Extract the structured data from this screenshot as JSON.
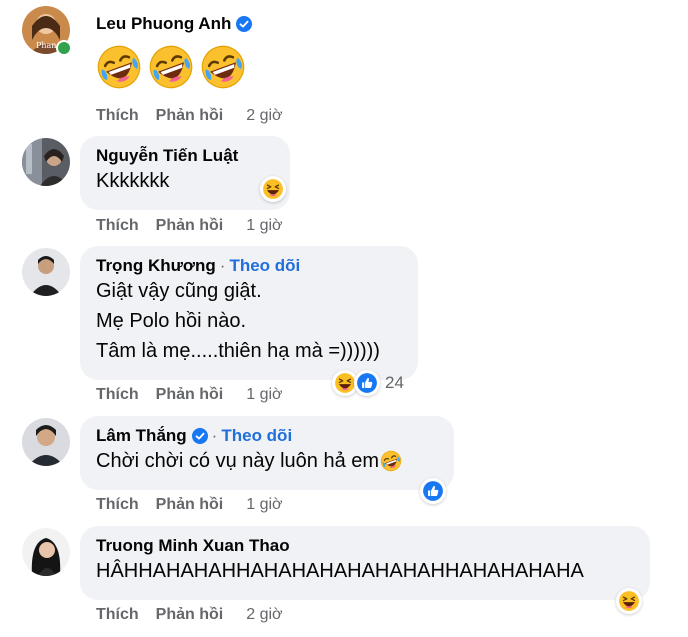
{
  "actions": {
    "like": "Thích",
    "reply": "Phản hồi"
  },
  "comments": [
    {
      "author": "Leu Phuong Anh",
      "verified": true,
      "online": true,
      "avatar_text": "Phan",
      "content_icons": [
        "rofl-emoji",
        "rofl-emoji",
        "rofl-emoji"
      ],
      "time": "2 giờ"
    },
    {
      "author": "Nguyễn Tiến Luật",
      "lines": [
        "Kkkkkkk"
      ],
      "reactions": [
        "haha-icon"
      ],
      "time": "1 giờ"
    },
    {
      "author": "Trọng Khương",
      "follow": "Theo dõi",
      "lines": [
        "Giật vậy cũng giật.",
        "Mẹ Polo hồi nào.",
        "Tâm là mẹ.....thiên hạ mà =))))))"
      ],
      "reactions": [
        "haha-icon",
        "like-icon"
      ],
      "reaction_count": "24",
      "time": "1 giờ"
    },
    {
      "author": "Lâm Thắng",
      "verified": true,
      "follow": "Theo dõi",
      "lines": [
        "Chời chời có vụ này luôn hả em"
      ],
      "inline_emoji": "rofl-emoji",
      "reactions": [
        "like-icon"
      ],
      "time": "1 giờ"
    },
    {
      "author": "Truong Minh Xuan Thao",
      "lines": [
        "HÂHHAHAHAHHAHAHAHAHAHAHAHHAHAHAHAHA"
      ],
      "reactions": [
        "haha-icon"
      ],
      "time": "2 giờ"
    }
  ]
}
